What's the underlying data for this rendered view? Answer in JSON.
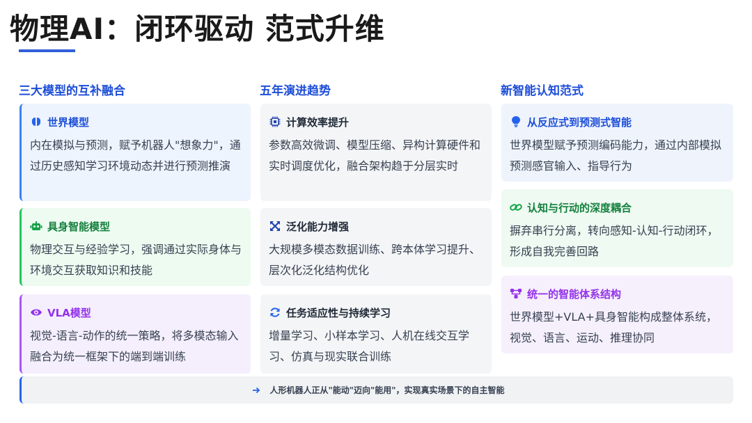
{
  "page": {
    "title": "物理AI：闭环驱动 范式升维"
  },
  "columns": [
    {
      "heading": "三大模型的互补融合",
      "cards": [
        {
          "icon": "brain-icon",
          "title": "世界模型",
          "body": "内在模拟与预测，赋予机器人\"想象力\"，通过历史感知学习环境动态并进行预测推演"
        },
        {
          "icon": "robot-icon",
          "title": "具身智能模型",
          "body": "物理交互与经验学习，强调通过实际身体与环境交互获取知识和技能"
        },
        {
          "icon": "eye-icon",
          "title": "VLA模型",
          "body": "视觉-语言-动作的统一策略，将多模态输入融合为统一框架下的端到端训练"
        }
      ]
    },
    {
      "heading": "五年演进趋势",
      "cards": [
        {
          "icon": "chip-icon",
          "title": "计算效率提升",
          "body": "参数高效微调、模型压缩、异构计算硬件和实时调度优化，融合架构趋于分层实时"
        },
        {
          "icon": "expand-icon",
          "title": "泛化能力增强",
          "body": "大规模多模态数据训练、跨本体学习提升、层次化泛化结构优化"
        },
        {
          "icon": "refresh-icon",
          "title": "任务适应性与持续学习",
          "body": "增量学习、小样本学习、人机在线交互学习、仿真与现实联合训练"
        }
      ]
    },
    {
      "heading": "新智能认知范式",
      "cards": [
        {
          "icon": "lightbulb-icon",
          "title": "从反应式到预测式智能",
          "body": "世界模型赋予预测编码能力，通过内部模拟预测感官输入、指导行为"
        },
        {
          "icon": "link-icon",
          "title": "认知与行动的深度耦合",
          "body": "摒弃串行分离，转向感知-认知-行动闭环，形成自我完善回路"
        },
        {
          "icon": "network-icon",
          "title": "统一的智能体系结构",
          "body": "世界模型+VLA+具身智能构成整体系统，视觉、语言、运动、推理协同"
        }
      ]
    }
  ],
  "footer": {
    "icon": "arrow-right-icon",
    "text": "人形机器人正从\"能动\"迈向\"能用\"，实现真实场景下的自主智能"
  },
  "colors": {
    "accent_blue": "#2563eb",
    "heading_blue": "#1d4ed8",
    "green": "#16a34a",
    "purple": "#9333ea"
  }
}
